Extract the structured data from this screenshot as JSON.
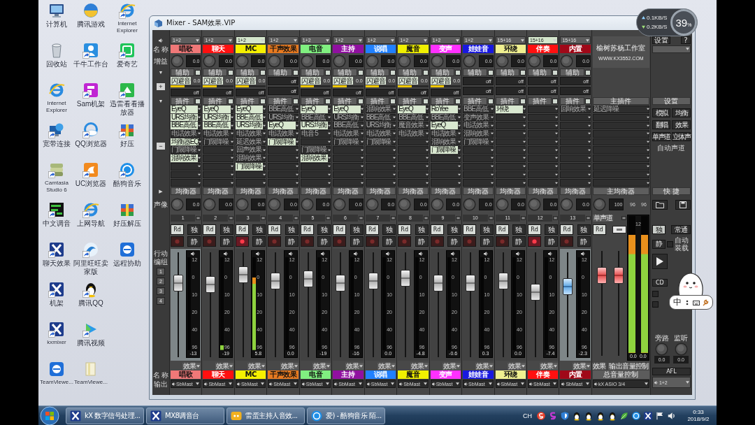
{
  "desktop_icons": [
    {
      "label": "计算机",
      "kind": "computer",
      "shortcut": false
    },
    {
      "label": "回收站",
      "kind": "bin",
      "shortcut": false
    },
    {
      "label": "Internet Explorer",
      "kind": "ie",
      "shortcut": false
    },
    {
      "label": "宽带连接",
      "kind": "network",
      "shortcut": true
    },
    {
      "label": "Camtasia Studio 6",
      "kind": "camtasia",
      "shortcut": true
    },
    {
      "label": "中文调音",
      "kind": "prof",
      "shortcut": true
    },
    {
      "label": "聊天效果",
      "kind": "kx",
      "shortcut": true
    },
    {
      "label": "机架",
      "kind": "kx",
      "shortcut": true
    },
    {
      "label": "kxmixer",
      "kind": "kx",
      "shortcut": true
    },
    {
      "label": "TeamViewe...",
      "kind": "teamviewer",
      "shortcut": false
    },
    {
      "label": "腾讯游戏",
      "kind": "orb",
      "shortcut": false
    },
    {
      "label": "千牛工作台",
      "kind": "qianniu",
      "shortcut": true
    },
    {
      "label": "Sam机架",
      "kind": "sam",
      "shortcut": true
    },
    {
      "label": "QQ浏览器",
      "kind": "qqbrowser",
      "shortcut": true
    },
    {
      "label": "UC浏览器",
      "kind": "uc",
      "shortcut": true
    },
    {
      "label": "上网导航",
      "kind": "ie",
      "shortcut": true
    },
    {
      "label": "阿里旺旺卖家版",
      "kind": "swirl",
      "shortcut": true
    },
    {
      "label": "腾讯QQ",
      "kind": "penguin",
      "shortcut": true
    },
    {
      "label": "腾讯视频",
      "kind": "video",
      "shortcut": true
    },
    {
      "label": "TeamViewe...",
      "kind": "document",
      "shortcut": false
    },
    {
      "label": "Internet Explorer",
      "kind": "ie",
      "shortcut": true
    },
    {
      "label": "爱奇艺",
      "kind": "iqiyi",
      "shortcut": true
    },
    {
      "label": "迅雷看看播放器",
      "kind": "greentile",
      "shortcut": true
    },
    {
      "label": "好压",
      "kind": "zip",
      "shortcut": true
    },
    {
      "label": "酷狗音乐",
      "kind": "kcircle",
      "shortcut": true
    },
    {
      "label": "好压解压",
      "kind": "zip",
      "shortcut": false
    },
    {
      "label": "远程协助",
      "kind": "teamviewer",
      "shortcut": false
    }
  ],
  "window": {
    "title": "Mixer - SAM效果.VIP"
  },
  "mixer": {
    "row_labels": {
      "name": "名 称",
      "gain": "增益",
      "aux_toggle": "▼",
      "aux_add": "+",
      "fx_toggle": "▼",
      "fx_remove": "−",
      "eq_toggle": "▶",
      "pan": "声像",
      "group_a": "行动",
      "group_b": "编组",
      "groups": [
        "1",
        "2",
        "3",
        "4"
      ],
      "name_bottom": "名 称",
      "output": "输出"
    },
    "channels": [
      {
        "input": {
          "label": "1+2",
          "active": false
        },
        "name": "唱歌",
        "color": "#f07878",
        "gain": "0.0",
        "aux_title": "辅助",
        "sends": [
          {
            "kind": "send",
            "label": "闪避音",
            "value": "0.0",
            "level": 0.45
          },
          {
            "kind": "off",
            "label": "off"
          }
        ],
        "fx_title": "插件",
        "slots": [
          {
            "kind": "plugin",
            "label": "EyeQ",
            "enabled": true
          },
          {
            "kind": "plugin",
            "label": "URS均衡",
            "enabled": true
          },
          {
            "kind": "plugin",
            "label": "BBE高低",
            "enabled": true
          },
          {
            "kind": "plugin",
            "label": "电话效果",
            "enabled": false
          },
          {
            "kind": "plugin",
            "label": "均衡器EQ",
            "enabled": true
          },
          {
            "kind": "plugin",
            "label": "门限降噪",
            "enabled": false
          },
          {
            "kind": "plugin",
            "label": "混响效果",
            "enabled": true
          },
          {
            "kind": "empty"
          },
          {
            "kind": "empty"
          },
          {
            "kind": "empty"
          }
        ],
        "eq_title": "均衡器",
        "pan": "0.0",
        "number": "1",
        "rd": "Rd",
        "solo": "独",
        "armed": false,
        "mute": "静",
        "highlighted": true,
        "selected": false,
        "fader": {
          "level": 0.75
        },
        "meter": {
          "scale": [
            "12",
            "0",
            "10",
            "20",
            "40",
            "96"
          ],
          "reading": "-13"
        },
        "effect": "效果",
        "name_bottom": "唱歌",
        "output": "SbMast"
      },
      {
        "input": {
          "label": "1+2",
          "active": false
        },
        "name": "聊天",
        "color": "#ff1010",
        "gain": "0.0",
        "aux_title": "辅助",
        "sends": [
          {
            "kind": "send",
            "label": "闪避音",
            "value": "0.0",
            "level": 0.45
          },
          {
            "kind": "off",
            "label": "off"
          }
        ],
        "fx_title": "插件",
        "slots": [
          {
            "kind": "plugin",
            "label": "EyeQ",
            "enabled": true
          },
          {
            "kind": "plugin",
            "label": "URS均衡",
            "enabled": true
          },
          {
            "kind": "plugin",
            "label": "BBE高低",
            "enabled": true
          },
          {
            "kind": "plugin",
            "label": "电话效果",
            "enabled": false
          },
          {
            "kind": "plugin",
            "label": "门限降噪",
            "enabled": false
          },
          {
            "kind": "empty"
          },
          {
            "kind": "empty"
          },
          {
            "kind": "empty"
          },
          {
            "kind": "empty"
          },
          {
            "kind": "empty"
          }
        ],
        "eq_title": "均衡器",
        "pan": "0.0",
        "number": "2",
        "rd": "Rd",
        "solo": "独",
        "armed": false,
        "mute": "静",
        "highlighted": false,
        "selected": false,
        "fader": {
          "level": 0.73
        },
        "meter": {
          "level": 0.05,
          "scale": [
            "12",
            "0",
            "10",
            "20",
            "40",
            "96"
          ],
          "reading": "-19"
        },
        "effect": "效果",
        "name_bottom": "聊天",
        "output": "SbMast"
      },
      {
        "input": {
          "label": "1+2",
          "active": true
        },
        "name": "MC",
        "color": "#f5f000",
        "gain": "0.0",
        "aux_title": "辅助",
        "sends": [
          {
            "kind": "send",
            "label": "闪避音",
            "value": "0.0",
            "level": 0.45
          },
          {
            "kind": "off",
            "label": "off"
          }
        ],
        "fx_title": "插件",
        "slots": [
          {
            "kind": "plugin",
            "label": "EyeQ",
            "enabled": true
          },
          {
            "kind": "plugin",
            "label": "BBE高低",
            "enabled": true
          },
          {
            "kind": "plugin",
            "label": "URS均衡",
            "enabled": true
          },
          {
            "kind": "plugin",
            "label": "电话效果",
            "enabled": false
          },
          {
            "kind": "plugin",
            "label": "延迟效果",
            "enabled": false
          },
          {
            "kind": "plugin",
            "label": "回声效果",
            "enabled": false
          },
          {
            "kind": "plugin",
            "label": "混响效果",
            "enabled": false
          },
          {
            "kind": "plugin",
            "label": "门限降噪",
            "enabled": true
          },
          {
            "kind": "empty"
          },
          {
            "kind": "empty"
          }
        ],
        "eq_title": "均衡器",
        "pan": "0.0",
        "number": "3",
        "rd": "Rd",
        "solo": "独",
        "armed": true,
        "mute": "静",
        "highlighted": false,
        "selected": false,
        "fader": {
          "level": 0.84
        },
        "meter": {
          "level": 0.78,
          "scale": [
            "12",
            "0",
            "10",
            "20",
            "40",
            "96"
          ],
          "reading": "5.8"
        },
        "effect": "效果",
        "name_bottom": "MC",
        "output": "SbMast"
      },
      {
        "input": {
          "label": "1+2",
          "active": false
        },
        "name": "干声效果",
        "color": "#e87a20",
        "gain": "0.0",
        "aux_title": "辅助",
        "sends": [
          {
            "kind": "off",
            "label": "off"
          },
          {
            "kind": "off",
            "label": "off"
          }
        ],
        "fx_title": "插件",
        "slots": [
          {
            "kind": "plugin",
            "label": "BBE高低",
            "enabled": false
          },
          {
            "kind": "plugin",
            "label": "URS均衡",
            "enabled": false
          },
          {
            "kind": "plugin",
            "label": "EyeQ",
            "enabled": true
          },
          {
            "kind": "plugin",
            "label": "电话效果",
            "enabled": false
          },
          {
            "kind": "plugin",
            "label": "门限降噪",
            "enabled": true
          },
          {
            "kind": "empty"
          },
          {
            "kind": "empty"
          },
          {
            "kind": "empty"
          },
          {
            "kind": "empty"
          },
          {
            "kind": "empty"
          }
        ],
        "eq_title": "均衡器",
        "pan": "0.0",
        "number": "4",
        "rd": "Rd",
        "solo": "独",
        "armed": false,
        "mute": "静",
        "highlighted": false,
        "selected": false,
        "fader": {
          "level": 0.77
        },
        "meter": {
          "scale": [
            "12",
            "0",
            "10",
            "20",
            "40",
            "96"
          ],
          "reading": "0.0"
        },
        "effect": "效果",
        "name_bottom": "干声效果",
        "output": "SbMast"
      },
      {
        "input": {
          "label": "1+2",
          "active": false
        },
        "name": "电音",
        "color": "#80f080",
        "gain": "0.0",
        "aux_title": "辅助",
        "sends": [
          {
            "kind": "send",
            "label": "闪避音",
            "value": "0.0",
            "level": 0.45
          },
          {
            "kind": "off",
            "label": "off"
          }
        ],
        "fx_title": "插件",
        "slots": [
          {
            "kind": "plugin",
            "label": "EyeQ",
            "enabled": true
          },
          {
            "kind": "plugin",
            "label": "BBE高低",
            "enabled": false
          },
          {
            "kind": "plugin",
            "label": "URS均衡",
            "enabled": true
          },
          {
            "kind": "plugin",
            "label": "电音 5",
            "enabled": false
          },
          {
            "kind": "empty"
          },
          {
            "kind": "plugin",
            "label": "门限降噪",
            "enabled": false
          },
          {
            "kind": "plugin",
            "label": "混响效果",
            "enabled": true
          },
          {
            "kind": "empty"
          },
          {
            "kind": "empty"
          },
          {
            "kind": "empty"
          }
        ],
        "eq_title": "均衡器",
        "pan": "0.0",
        "number": "5",
        "rd": "Rd",
        "solo": "独",
        "armed": false,
        "mute": "静",
        "highlighted": false,
        "selected": false,
        "fader": {
          "level": 0.79
        },
        "meter": {
          "scale": [
            "12",
            "0",
            "10",
            "20",
            "40",
            "96"
          ],
          "reading": "-19"
        },
        "effect": "效果",
        "name_bottom": "电音",
        "output": "SbMast"
      },
      {
        "input": {
          "label": "1+2",
          "active": false
        },
        "name": "主持",
        "color": "#9010a0",
        "gain": "0.0",
        "aux_title": "辅助",
        "sends": [
          {
            "kind": "send",
            "label": "闪避音",
            "value": "0.0",
            "level": 0.45
          },
          {
            "kind": "off",
            "label": "off"
          }
        ],
        "fx_title": "插件",
        "slots": [
          {
            "kind": "plugin",
            "label": "EyeQ",
            "enabled": true
          },
          {
            "kind": "plugin",
            "label": "URS均衡",
            "enabled": false
          },
          {
            "kind": "plugin",
            "label": "BBE高低",
            "enabled": false
          },
          {
            "kind": "plugin",
            "label": "电话效果",
            "enabled": false
          },
          {
            "kind": "plugin",
            "label": "门限降噪",
            "enabled": false
          },
          {
            "kind": "empty"
          },
          {
            "kind": "empty"
          },
          {
            "kind": "empty"
          },
          {
            "kind": "empty"
          },
          {
            "kind": "empty"
          }
        ],
        "eq_title": "均衡器",
        "pan": "0.0",
        "number": "6",
        "rd": "Rd",
        "solo": "独",
        "armed": false,
        "mute": "静",
        "highlighted": false,
        "selected": false,
        "fader": {
          "level": 0.75
        },
        "meter": {
          "scale": [
            "12",
            "0",
            "10",
            "20",
            "40",
            "96"
          ],
          "reading": "-16"
        },
        "effect": "效果",
        "name_bottom": "主持",
        "output": "SbMast"
      },
      {
        "input": {
          "label": "1+2",
          "active": false
        },
        "name": "说唱",
        "color": "#2080ff",
        "gain": "0.0",
        "aux_title": "辅助",
        "sends": [
          {
            "kind": "send",
            "label": "闪避音",
            "value": "0.0",
            "level": 0.45
          },
          {
            "kind": "off",
            "label": "off"
          }
        ],
        "fx_title": "插件",
        "slots": [
          {
            "kind": "plugin",
            "label": "混响效果",
            "enabled": false
          },
          {
            "kind": "plugin",
            "label": "BBE高低",
            "enabled": false
          },
          {
            "kind": "plugin",
            "label": "URS均衡",
            "enabled": false
          },
          {
            "kind": "plugin",
            "label": "电话效果",
            "enabled": false
          },
          {
            "kind": "plugin",
            "label": "门限降噪",
            "enabled": false
          },
          {
            "kind": "empty"
          },
          {
            "kind": "empty"
          },
          {
            "kind": "empty"
          },
          {
            "kind": "empty"
          },
          {
            "kind": "empty"
          }
        ],
        "eq_title": "均衡器",
        "pan": "0.0",
        "number": "7",
        "rd": "Rd",
        "solo": "独",
        "armed": false,
        "mute": "静",
        "highlighted": false,
        "selected": false,
        "fader": {
          "level": 0.77
        },
        "meter": {
          "scale": [
            "12",
            "0",
            "10",
            "20",
            "40",
            "96"
          ],
          "reading": "0.0"
        },
        "effect": "效果",
        "name_bottom": "说唱",
        "output": "SbMast"
      },
      {
        "input": {
          "label": "1+2",
          "active": false
        },
        "name": "魔音",
        "color": "#f0f000",
        "gain": "0.0",
        "aux_title": "辅助",
        "sends": [
          {
            "kind": "send",
            "label": "闪避音",
            "value": "0.0",
            "level": 0.45
          },
          {
            "kind": "off",
            "label": "off"
          }
        ],
        "fx_title": "插件",
        "slots": [
          {
            "kind": "plugin",
            "label": "EyeQ",
            "enabled": true
          },
          {
            "kind": "plugin",
            "label": "BBE高低",
            "enabled": false
          },
          {
            "kind": "plugin",
            "label": "魔音效果",
            "enabled": false
          },
          {
            "kind": "plugin",
            "label": "电话效果",
            "enabled": false
          },
          {
            "kind": "empty"
          },
          {
            "kind": "empty"
          },
          {
            "kind": "empty"
          },
          {
            "kind": "empty"
          },
          {
            "kind": "empty"
          },
          {
            "kind": "empty"
          }
        ],
        "eq_title": "均衡器",
        "pan": "0.0",
        "number": "8",
        "rd": "Rd",
        "solo": "独",
        "armed": false,
        "mute": "静",
        "highlighted": false,
        "selected": false,
        "fader": {
          "level": 0.8
        },
        "meter": {
          "scale": [
            "12",
            "0",
            "10",
            "20",
            "40",
            "96"
          ],
          "reading": "-4.8"
        },
        "effect": "效果",
        "name_bottom": "魔音",
        "output": "SbMast"
      },
      {
        "input": {
          "label": "1+2",
          "active": false
        },
        "name": "变声",
        "color": "#ff30ff",
        "gain": "0.0",
        "aux_title": "辅助",
        "sends": [
          {
            "kind": "send",
            "label": "闪避音",
            "value": "0.0",
            "level": 0.45
          },
          {
            "kind": "off",
            "label": "off"
          }
        ],
        "fx_title": "插件",
        "slots": [
          {
            "kind": "plugin",
            "label": "RoYee",
            "enabled": true
          },
          {
            "kind": "plugin",
            "label": "BBE高低",
            "enabled": false
          },
          {
            "kind": "plugin",
            "label": "EyeQ",
            "enabled": true
          },
          {
            "kind": "plugin",
            "label": "电话效果",
            "enabled": false
          },
          {
            "kind": "plugin",
            "label": "混响效果",
            "enabled": false
          },
          {
            "kind": "plugin",
            "label": "门限降噪",
            "enabled": true
          },
          {
            "kind": "empty"
          },
          {
            "kind": "empty"
          },
          {
            "kind": "empty"
          },
          {
            "kind": "empty"
          }
        ],
        "eq_title": "均衡器",
        "pan": "0.0",
        "number": "9",
        "rd": "Rd",
        "solo": "独",
        "armed": false,
        "mute": "静",
        "highlighted": false,
        "selected": false,
        "fader": {
          "level": 0.75
        },
        "meter": {
          "scale": [
            "12",
            "0",
            "10",
            "20",
            "40",
            "96"
          ],
          "reading": "-0.6"
        },
        "effect": "效果",
        "name_bottom": "变声",
        "output": "SbMast"
      },
      {
        "input": {
          "label": "1+2",
          "active": false
        },
        "name": "娃娃音",
        "color": "#1818e0",
        "gain": "0.0",
        "aux_title": "辅助",
        "sends": [
          {
            "kind": "off",
            "label": "off"
          },
          {
            "kind": "off",
            "label": "off"
          }
        ],
        "fx_title": "插件",
        "slots": [
          {
            "kind": "plugin",
            "label": "BBE高低",
            "enabled": false
          },
          {
            "kind": "plugin",
            "label": "变声效果",
            "enabled": false
          },
          {
            "kind": "plugin",
            "label": "电话效果",
            "enabled": false
          },
          {
            "kind": "plugin",
            "label": "混响效果",
            "enabled": false
          },
          {
            "kind": "plugin",
            "label": "门限降噪",
            "enabled": false
          },
          {
            "kind": "empty"
          },
          {
            "kind": "empty"
          },
          {
            "kind": "empty"
          },
          {
            "kind": "empty"
          },
          {
            "kind": "empty"
          }
        ],
        "eq_title": "均衡器",
        "pan": "0.0",
        "number": "10",
        "rd": "Rd",
        "solo": "独",
        "armed": false,
        "mute": "静",
        "highlighted": false,
        "selected": false,
        "fader": {
          "level": 0.75
        },
        "meter": {
          "scale": [
            "12",
            "0",
            "10",
            "20",
            "40",
            "96"
          ],
          "reading": "0.3"
        },
        "effect": "效果",
        "name_bottom": "娃娃音",
        "output": "SbMast"
      },
      {
        "input": {
          "label": "15+16",
          "active": false
        },
        "name": "环绕",
        "color": "#f0f090",
        "gain": "0.0",
        "aux_title": "辅助",
        "sends": [
          {
            "kind": "off",
            "label": "off"
          },
          {
            "kind": "off",
            "label": "off"
          }
        ],
        "fx_title": "插件",
        "slots": [
          {
            "kind": "plugin",
            "label": "环绕",
            "enabled": true
          },
          {
            "kind": "empty"
          },
          {
            "kind": "empty"
          },
          {
            "kind": "empty"
          },
          {
            "kind": "empty"
          },
          {
            "kind": "empty"
          },
          {
            "kind": "empty"
          },
          {
            "kind": "empty"
          },
          {
            "kind": "empty"
          },
          {
            "kind": "empty"
          }
        ],
        "eq_title": "均衡器",
        "pan": "0.0",
        "number": "11",
        "rd": "Rd",
        "solo": "独",
        "armed": false,
        "mute": "静",
        "highlighted": false,
        "selected": false,
        "fader": {
          "level": 0.77
        },
        "meter": {
          "scale": [
            "12",
            "0",
            "10",
            "20",
            "40",
            "96"
          ],
          "reading": "0.0"
        },
        "effect": "效果",
        "name_bottom": "环绕",
        "output": "SbMast"
      },
      {
        "input": {
          "label": "15+16",
          "active": true
        },
        "name": "伴奏",
        "color": "#ff1010",
        "gain": "0.0",
        "aux_title": "辅助",
        "sends": [
          {
            "kind": "off",
            "label": "off"
          },
          {
            "kind": "off",
            "label": "off"
          }
        ],
        "fx_title": "插件",
        "slots": [
          {
            "kind": "empty"
          },
          {
            "kind": "empty"
          },
          {
            "kind": "empty"
          },
          {
            "kind": "empty"
          },
          {
            "kind": "empty"
          },
          {
            "kind": "empty"
          },
          {
            "kind": "empty"
          },
          {
            "kind": "empty"
          },
          {
            "kind": "empty"
          },
          {
            "kind": "empty"
          }
        ],
        "eq_title": "均衡器",
        "pan": "0.0",
        "number": "12",
        "rd": "Rd",
        "solo": "独",
        "armed": true,
        "mute": "静",
        "highlighted": false,
        "selected": false,
        "fader": {
          "level": 0.64
        },
        "meter": {
          "scale": [
            "12",
            "0",
            "10",
            "20",
            "40",
            "96"
          ],
          "reading": "-7.4"
        },
        "effect": "效果",
        "name_bottom": "伴奏",
        "output": "SbMast"
      },
      {
        "input": {
          "label": "15+16",
          "active": false
        },
        "name": "内置",
        "color": "#a00818",
        "gain": "0.0",
        "aux_title": "辅助",
        "sends": [
          {
            "kind": "off",
            "label": "off"
          },
          {
            "kind": "off",
            "label": "off"
          }
        ],
        "fx_title": "插件",
        "slots": [
          {
            "kind": "plugin",
            "label": "回响效果",
            "enabled": false
          },
          {
            "kind": "empty"
          },
          {
            "kind": "empty"
          },
          {
            "kind": "empty"
          },
          {
            "kind": "empty"
          },
          {
            "kind": "empty"
          },
          {
            "kind": "empty"
          },
          {
            "kind": "empty"
          },
          {
            "kind": "empty"
          },
          {
            "kind": "empty"
          }
        ],
        "eq_title": "均衡器",
        "pan": "0.0",
        "number": "13",
        "rd": "Rd",
        "solo": "独",
        "armed": false,
        "mute": "静",
        "highlighted": true,
        "selected": true,
        "fader": {
          "level": 0.71
        },
        "meter": {
          "scale": [
            "12",
            "0",
            "10",
            "20",
            "40",
            "96"
          ],
          "reading": "-2.3"
        },
        "effect": "效果",
        "name_bottom": "内置",
        "output": "SbMast"
      }
    ],
    "master": {
      "studio": "榆树苏杨工作室",
      "url": "WWW.KX3552.COM",
      "fx_title": "主插件",
      "slots": [
        {
          "kind": "plugin",
          "label": "延迟降噪",
          "enabled": false
        },
        {
          "kind": "empty"
        },
        {
          "kind": "empty"
        },
        {
          "kind": "empty"
        },
        {
          "kind": "empty"
        },
        {
          "kind": "empty"
        },
        {
          "kind": "empty"
        },
        {
          "kind": "empty"
        },
        {
          "kind": "empty"
        },
        {
          "kind": "empty"
        }
      ],
      "eq_title": "主均衡器",
      "pan": "100",
      "peaks": [
        "96",
        "96"
      ],
      "mono": "单声道",
      "rd": "Rd",
      "faders": [
        {
          "level": 0.82
        },
        {
          "level": 0.82
        }
      ],
      "meters": [
        {
          "level": 0.86
        },
        {
          "level": 0.86
        }
      ],
      "scale": [
        "12"
      ],
      "readings": [
        "0.0",
        "0.0"
      ],
      "effect": "效果",
      "output_control": "输出音量控制",
      "name": "总音量控制",
      "output": "kX ASIO 3/4"
    },
    "panel": {
      "settings": "设置",
      "help": "?",
      "section_title": "设置",
      "mode_buttons": [
        "模拟",
        "均衡",
        "翻唱",
        "效果",
        "单声道",
        "立体声"
      ],
      "auto_channel": "自动声道",
      "shortcut_title": "快 捷",
      "solo": "独",
      "always_on": "常通",
      "mute": "静",
      "auto_load": {
        "label": "自动装载",
        "checked": false
      },
      "cd": "CD",
      "options": [
        {
          "checked": false
        },
        {
          "checked": false
        }
      ],
      "bypass": "旁路",
      "monitor": "监听",
      "knob_values": [
        "0.0",
        "0.0"
      ],
      "afl": "AFL",
      "output": "1+2"
    }
  },
  "network_widget": {
    "rates": [
      {
        "kind": "up",
        "text": "0.1KB/S"
      },
      {
        "kind": "down",
        "text": "0.2KB/S"
      }
    ],
    "percent": "39",
    "percent_unit": "%"
  },
  "ime_sticker": {
    "language": "中"
  },
  "taskbar": {
    "tasks": [
      {
        "label": "kX 数字信号处理...",
        "kind": "kx"
      },
      {
        "label": "MX8调音台",
        "kind": "kx"
      },
      {
        "label": "雷蛋主持人音效...",
        "kind": "chat"
      },
      {
        "label": "爱) - 酷狗音乐 陌...",
        "kind": "kcircle"
      }
    ],
    "language": "CH",
    "tray": [
      {
        "kind": "sred"
      },
      {
        "kind": "spurple"
      },
      {
        "kind": "shield"
      },
      {
        "kind": "penguin"
      },
      {
        "kind": "penguin"
      },
      {
        "kind": "penguin"
      },
      {
        "kind": "penguin"
      },
      {
        "kind": "leaf"
      },
      {
        "kind": "kcircle"
      },
      {
        "kind": "kx"
      },
      {
        "kind": "flag"
      },
      {
        "kind": "speaker"
      }
    ],
    "time": "0:33",
    "date": "2018/9/2"
  }
}
